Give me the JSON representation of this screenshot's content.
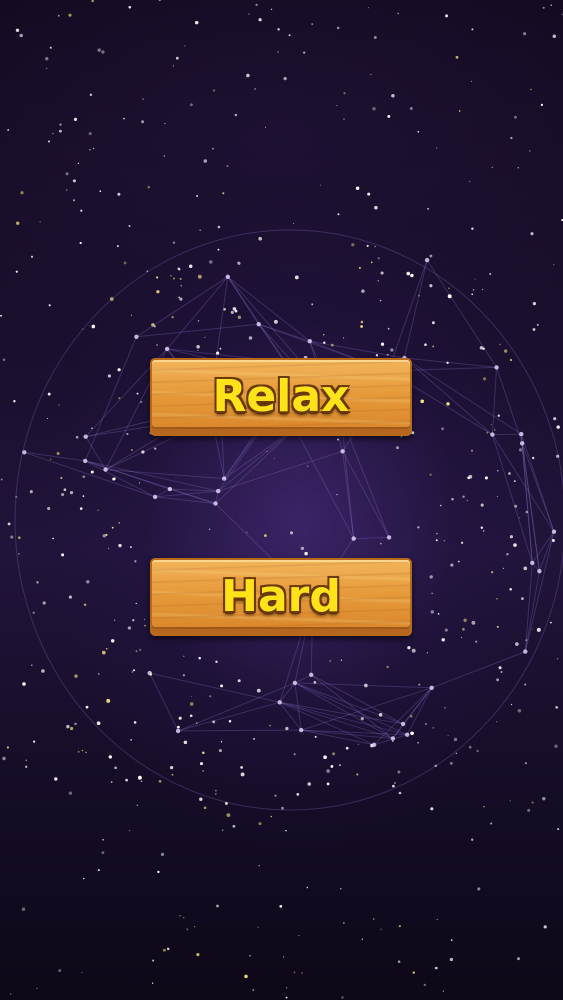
{
  "menu": {
    "relax_label": "Relax",
    "hard_label": "Hard"
  },
  "colors": {
    "background": "#1a0f2e",
    "nebula": "#3e2a6e",
    "star": "#ffffff",
    "button_wood": "#e69a3a",
    "button_text": "#ffe21a"
  }
}
